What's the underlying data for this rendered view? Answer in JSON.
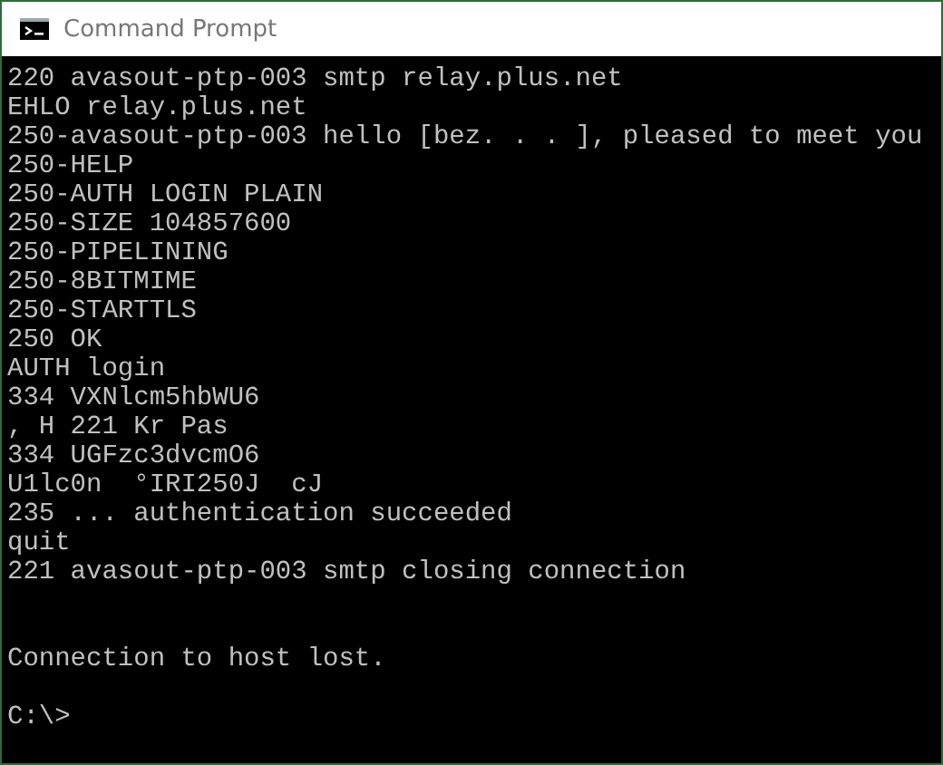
{
  "window": {
    "title": "Command Prompt"
  },
  "console": {
    "session": [
      "220 avasout-ptp-003 smtp relay.plus.net",
      "EHLO relay.plus.net",
      "250-avasout-ptp-003 hello [bez. . . ], pleased to meet you",
      "250-HELP",
      "250-AUTH LOGIN PLAIN",
      "250-SIZE 104857600",
      "250-PIPELINING",
      "250-8BITMIME",
      "250-STARTTLS",
      "250 OK",
      "AUTH login",
      "334 VXNlcm5hbWU6",
      ", H 221 Kr Pas",
      "334 UGFzc3dvcmO6",
      "U1lc0n  °IRI250J  cJ",
      "235 ... authentication succeeded",
      "quit",
      "221 avasout-ptp-003 smtp closing connection"
    ],
    "status": "Connection to host lost.",
    "prompt": "C:\\>"
  }
}
